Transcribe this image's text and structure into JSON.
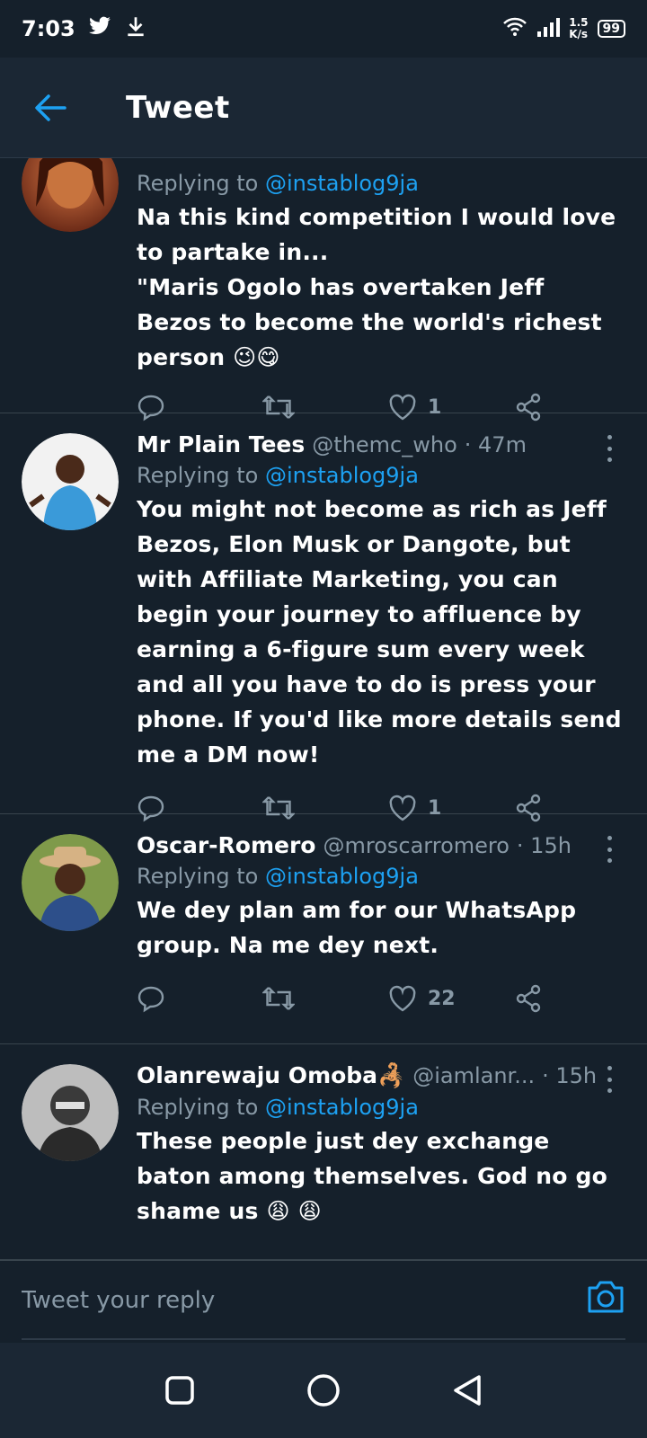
{
  "status_bar": {
    "time": "7:03",
    "net_speed": "1.5\nK/s",
    "battery": "99"
  },
  "header": {
    "title": "Tweet"
  },
  "tweets": [
    {
      "name": "",
      "handle": "",
      "time": "",
      "replying_prefix": "Replying to",
      "replying_to": "@instablog9ja",
      "text": "Na this kind competition I would love to partake in...\n\"Maris Ogolo has overtaken Jeff Bezos to become the world's richest person 😉😋",
      "likes": "1",
      "avatar_color": "#b5572b"
    },
    {
      "name": "Mr Plain Tees",
      "handle": "@themc_who",
      "time": "· 47m",
      "replying_prefix": "Replying to",
      "replying_to": "@instablog9ja",
      "text": "You might not become as rich as Jeff Bezos, Elon Musk or Dangote, but with Affiliate Marketing, you can begin your journey to affluence by earning a 6-figure sum every week and all you have to do is press your phone. If you'd like more details send me a DM now!",
      "likes": "1",
      "avatar_color": "#3a9ad9"
    },
    {
      "name": "Oscar-Romero",
      "handle": "@mroscarromero",
      "time": "· 15h",
      "replying_prefix": "Replying to",
      "replying_to": "@instablog9ja",
      "text": "We dey plan am for our WhatsApp group. Na me dey next.",
      "likes": "22",
      "avatar_color": "#6b8a3a"
    },
    {
      "name": "Olanrewaju Omoba🦂",
      "handle": "@iamlanr...",
      "time": "· 15h",
      "replying_prefix": "Replying to",
      "replying_to": "@instablog9ja",
      "text": "These people just dey exchange baton among themselves. God no go shame us 😩 😩",
      "likes": "",
      "avatar_color": "#777777"
    }
  ],
  "reply_bar": {
    "placeholder": "Tweet your reply"
  },
  "colors": {
    "background": "#15202b",
    "accent": "#1da1f2",
    "muted": "#8899a6"
  }
}
